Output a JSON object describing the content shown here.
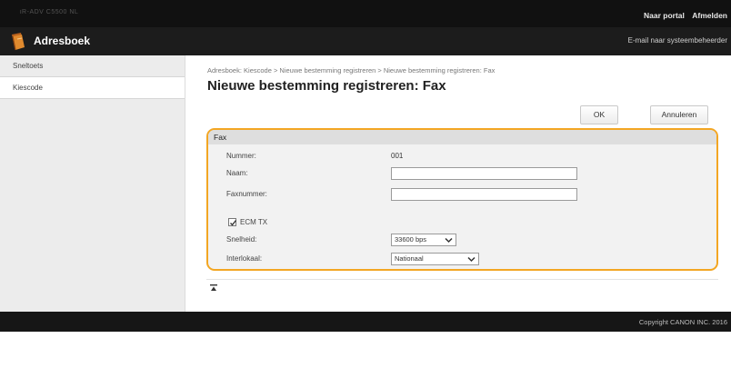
{
  "topbar": {
    "device_name": "iR-ADV C5500 NL",
    "portal_link": "Naar portal",
    "logout_link": "Afmelden"
  },
  "header": {
    "app_title": "Adresboek",
    "mail_admin_link": "E-mail naar systeembeheerder"
  },
  "sidebar": {
    "items": [
      {
        "label": "Sneltoets"
      },
      {
        "label": "Kiescode"
      }
    ]
  },
  "main": {
    "breadcrumb": "Adresboek: Kiescode > Nieuwe bestemming registreren > Nieuwe bestemming registreren: Fax",
    "title": "Nieuwe bestemming registreren: Fax",
    "ok_label": "OK",
    "cancel_label": "Annuleren"
  },
  "form": {
    "section_title": "Fax",
    "number_label": "Nummer:",
    "number_value": "001",
    "name_label": "Naam:",
    "name_value": "",
    "fax_label": "Faxnummer:",
    "fax_value": "",
    "ecm_label": "ECM TX",
    "ecm_checked": true,
    "speed_label": "Snelheid:",
    "speed_value": "33600 bps",
    "interlocal_label": "Interlokaal:",
    "interlocal_value": "Nationaal"
  },
  "footer": {
    "copyright": "Copyright CANON INC. 2016"
  },
  "colors": {
    "highlight": "#f3a623",
    "header_bg": "#1c1c1c",
    "topbar_bg": "#111111"
  },
  "icons": {
    "app": "address-book-icon",
    "checkbox": "checkmark-icon",
    "dropdown": "chevron-down-icon",
    "to_top": "to-top-icon"
  }
}
